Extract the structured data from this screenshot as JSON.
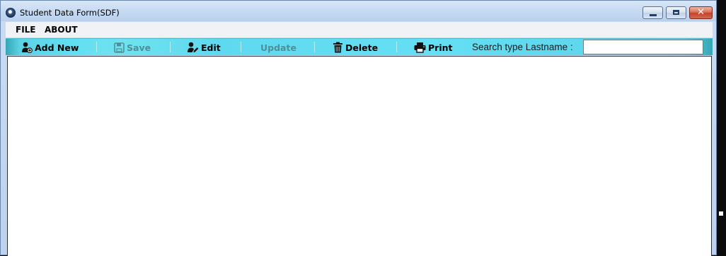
{
  "window": {
    "title": "Student Data Form(SDF)"
  },
  "menu": {
    "items": [
      "FILE",
      "ABOUT"
    ]
  },
  "toolbar": {
    "add_new": "Add New",
    "save": "Save",
    "edit": "Edit",
    "update": "Update",
    "delete": "Delete",
    "print": "Print",
    "search_label": "Search type Lastname :",
    "search_value": ""
  },
  "icons": {
    "app": "app-icon",
    "add_new": "user-add-icon",
    "save": "floppy-disk-icon",
    "edit": "user-edit-icon",
    "delete": "trash-icon",
    "print": "printer-icon"
  },
  "colors": {
    "toolbar_accent": "#5fd9ef",
    "disabled_text": "#4f8f99",
    "close_button": "#c3422a"
  }
}
